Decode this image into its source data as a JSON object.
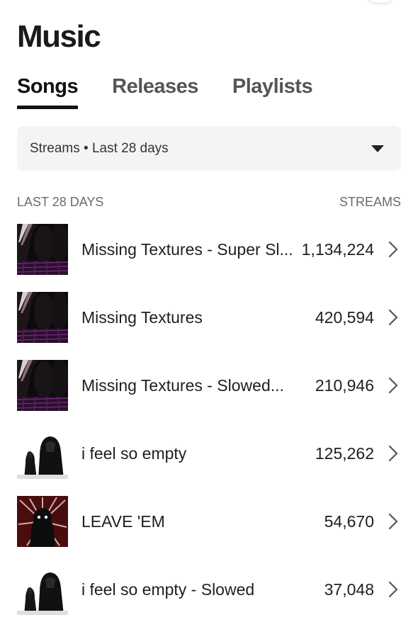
{
  "page": {
    "title": "Music"
  },
  "tabs": [
    {
      "label": "Songs",
      "active": true
    },
    {
      "label": "Releases",
      "active": false
    },
    {
      "label": "Playlists",
      "active": false
    }
  ],
  "filter": {
    "label": "Streams • Last 28 days",
    "icon": "caret-down-icon"
  },
  "list_header": {
    "left": "LAST 28 DAYS",
    "right": "STREAMS"
  },
  "songs": [
    {
      "title": "Missing Textures - Super Sl...",
      "streams": "1,134,224",
      "art": "room"
    },
    {
      "title": "Missing Textures",
      "streams": "420,594",
      "art": "room"
    },
    {
      "title": "Missing Textures - Slowed...",
      "streams": "210,946",
      "art": "room"
    },
    {
      "title": "i feel so empty",
      "streams": "125,262",
      "art": "hooded"
    },
    {
      "title": "LEAVE 'EM",
      "streams": "54,670",
      "art": "figure-red"
    },
    {
      "title": "i feel so empty - Slowed",
      "streams": "37,048",
      "art": "hooded"
    }
  ],
  "colors": {
    "text": "#1a1a1a",
    "muted": "#6b6b6b",
    "filter_bg": "#f4f4f4"
  }
}
